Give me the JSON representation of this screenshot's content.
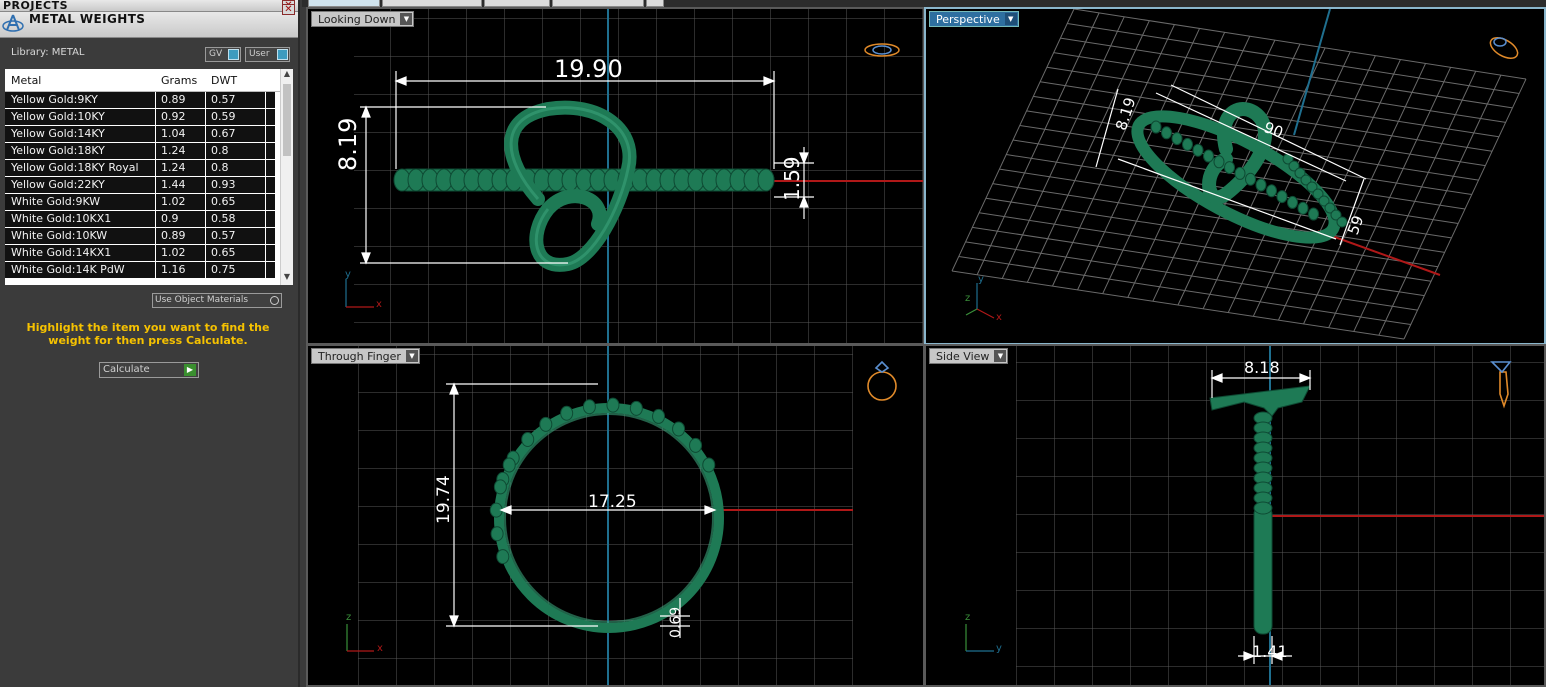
{
  "left_panel": {
    "projects_title": "PROJECTS",
    "metal_weights_title": "METAL WEIGHTS",
    "library_label": "Library: METAL",
    "gv_toggle": "GV",
    "user_toggle": "User",
    "table": {
      "headers": [
        "Metal",
        "Grams",
        "DWT"
      ],
      "rows": [
        {
          "metal": "Yellow Gold:9KY",
          "grams": "0.89",
          "dwt": "0.57"
        },
        {
          "metal": "Yellow Gold:10KY",
          "grams": "0.92",
          "dwt": "0.59"
        },
        {
          "metal": "Yellow Gold:14KY",
          "grams": "1.04",
          "dwt": "0.67"
        },
        {
          "metal": "Yellow Gold:18KY",
          "grams": "1.24",
          "dwt": "0.8"
        },
        {
          "metal": "Yellow Gold:18KY Royal",
          "grams": "1.24",
          "dwt": "0.8"
        },
        {
          "metal": "Yellow Gold:22KY",
          "grams": "1.44",
          "dwt": "0.93"
        },
        {
          "metal": "White Gold:9KW",
          "grams": "1.02",
          "dwt": "0.65"
        },
        {
          "metal": "White Gold:10KX1",
          "grams": "0.9",
          "dwt": "0.58"
        },
        {
          "metal": "White Gold:10KW",
          "grams": "0.89",
          "dwt": "0.57"
        },
        {
          "metal": "White Gold:14KX1",
          "grams": "1.02",
          "dwt": "0.65"
        },
        {
          "metal": "White Gold:14K PdW",
          "grams": "1.16",
          "dwt": "0.75"
        }
      ]
    },
    "use_object_materials": "Use Object Materials",
    "hint": "Highlight the item you want to find the weight for then press Calculate.",
    "calculate_label": "Calculate"
  },
  "viewports": {
    "looking_down": {
      "label": "Looking Down",
      "dim_width": "19.90",
      "dim_height": "8.19",
      "dim_band": "1.59",
      "axis_y": "y",
      "axis_x": "x"
    },
    "perspective": {
      "label": "Perspective",
      "dim_height": "8.19",
      "dim_width_partial": "90",
      "dim_band": "59",
      "axis_y": "y",
      "axis_z": "z",
      "axis_x": "x"
    },
    "through_finger": {
      "label": "Through Finger",
      "dim_height": "19.74",
      "dim_inner": "17.25",
      "dim_thickness": "0.69",
      "axis_z": "z",
      "axis_x": "x"
    },
    "side_view": {
      "label": "Side View",
      "dim_top": "8.18",
      "dim_bottom": "1.41",
      "axis_z": "z",
      "axis_y": "y"
    }
  },
  "colors": {
    "ring_green": "#1e7a55",
    "grid": "#5a5a5a",
    "axis_blue": "#1f6f8f",
    "axis_red": "#b01818",
    "active_label": "#2e6fa0",
    "hint_yellow": "#f6c200"
  }
}
